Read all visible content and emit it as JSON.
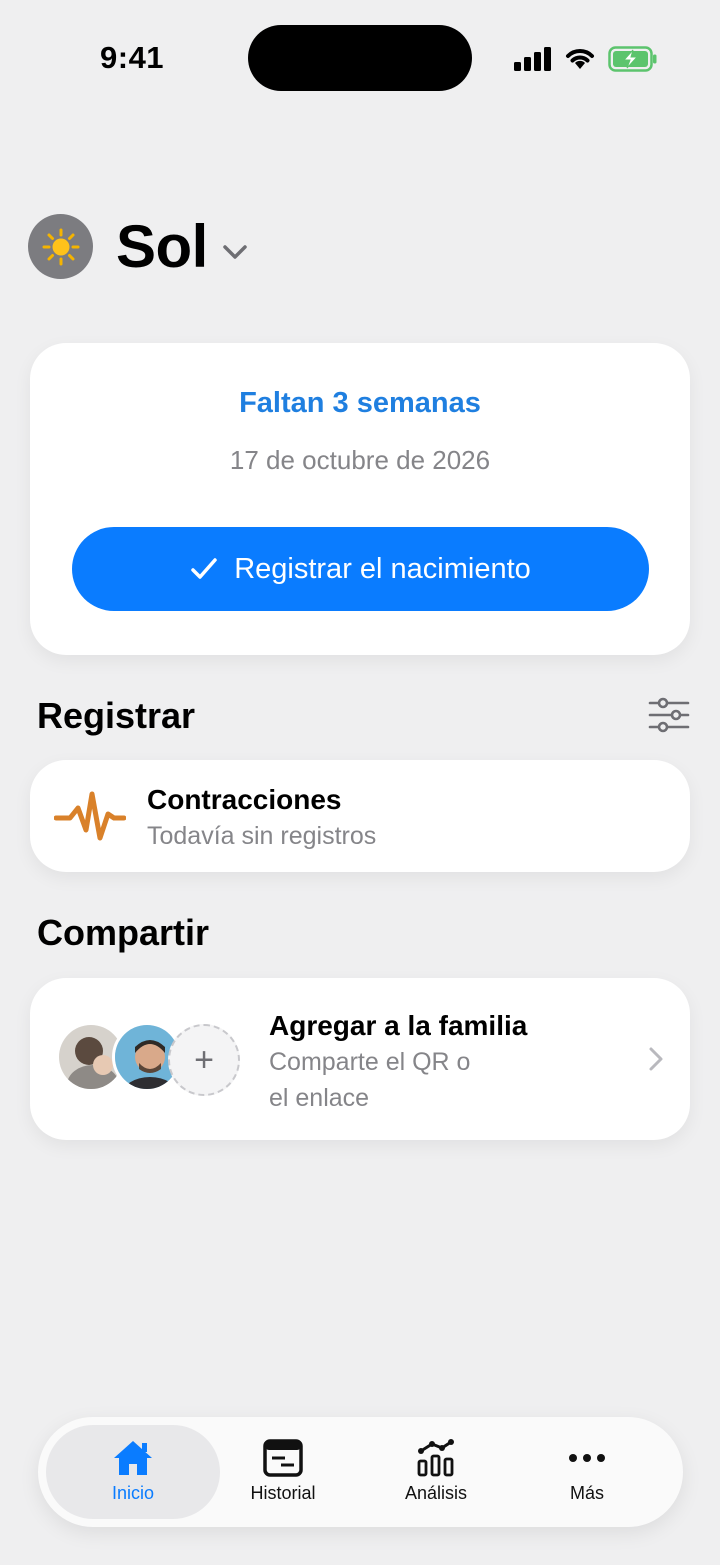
{
  "status_bar": {
    "time": "9:41"
  },
  "profile": {
    "name": "Sol",
    "avatar_icon": "sun-icon"
  },
  "due_card": {
    "title": "Faltan 3 semanas",
    "date": "17 de octubre de 2026",
    "button_label": "Registrar el nacimiento"
  },
  "register_section": {
    "title": "Registrar",
    "item": {
      "title": "Contracciones",
      "subtitle": "Todavía sin registros",
      "icon": "contraction-wave-icon"
    }
  },
  "share_section": {
    "title": "Compartir",
    "item": {
      "title": "Agregar a la familia",
      "subtitle_line1": "Comparte el QR o",
      "subtitle_line2": "el enlace"
    }
  },
  "tabbar": {
    "tabs": [
      {
        "label": "Inicio",
        "icon": "home-icon",
        "active": true
      },
      {
        "label": "Historial",
        "icon": "history-icon",
        "active": false
      },
      {
        "label": "Análisis",
        "icon": "analytics-icon",
        "active": false
      },
      {
        "label": "Más",
        "icon": "more-icon",
        "active": false
      }
    ]
  },
  "colors": {
    "accent": "#0a7cff",
    "title_blue": "#1f7fe0",
    "secondary_text": "#858589",
    "background": "#efeff0"
  }
}
